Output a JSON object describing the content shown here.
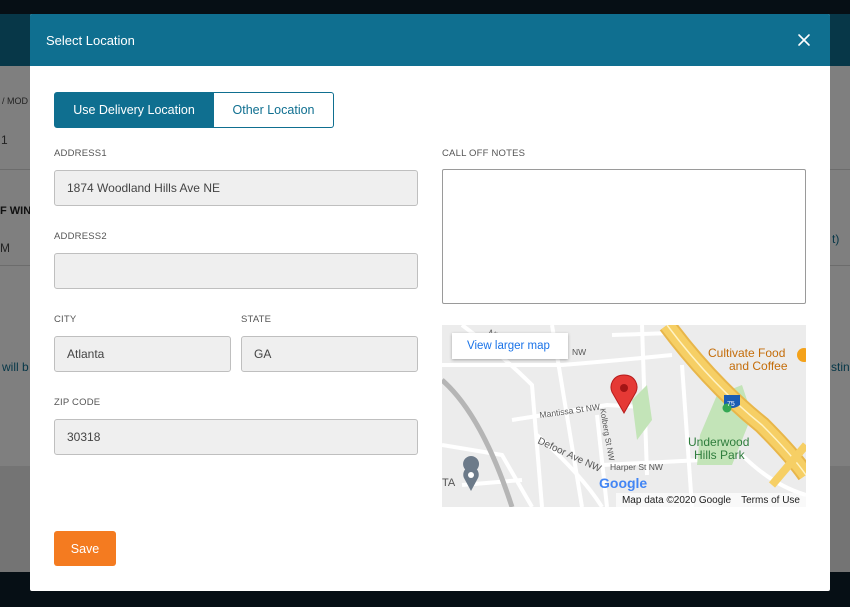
{
  "background": {
    "breadcrumb_fragment": "/ MOD",
    "row_fragment_1": "1",
    "row_fragment_2": "F WIN",
    "row_fragment_3": "M",
    "row_fragment_4": "will b",
    "right_fragment_1": "t)",
    "right_fragment_2": "sting"
  },
  "modal": {
    "title": "Select Location",
    "close_icon": "close-icon",
    "tabs": {
      "delivery": "Use Delivery Location",
      "other": "Other Location"
    },
    "fields": {
      "address1": {
        "label": "ADDRESS1",
        "value": "1874 Woodland Hills Ave NE"
      },
      "address2": {
        "label": "ADDRESS2",
        "value": ""
      },
      "city": {
        "label": "CITY",
        "value": "Atlanta"
      },
      "state": {
        "label": "STATE",
        "value": "GA"
      },
      "zip": {
        "label": "ZIP CODE",
        "value": "30318"
      },
      "notes": {
        "label": "CALL OFF NOTES",
        "value": ""
      }
    },
    "map": {
      "view_larger": "View larger map",
      "poi_cafe": "Cultivate Food",
      "poi_cafe_2": "and Coffee",
      "park_1": "Underwood",
      "park_2": "Hills Park",
      "street_mantissa": "Mantissa St NW",
      "street_defoor": "Defoor Ave NW",
      "street_harper": "Harper St NW",
      "street_kolberg": "Kolberg St NW",
      "street_top": "NW",
      "highway_shield": "75",
      "label_ta": "TA",
      "google_logo": "Google",
      "attribution": "Map data ©2020 Google",
      "terms": "Terms of Use",
      "colors": {
        "highway": "#f6cf65",
        "park": "#c3e4b8",
        "pin": "#e53935"
      }
    },
    "save_label": "Save"
  },
  "colors": {
    "primary": "#0f6f90",
    "save": "#f47b20"
  }
}
